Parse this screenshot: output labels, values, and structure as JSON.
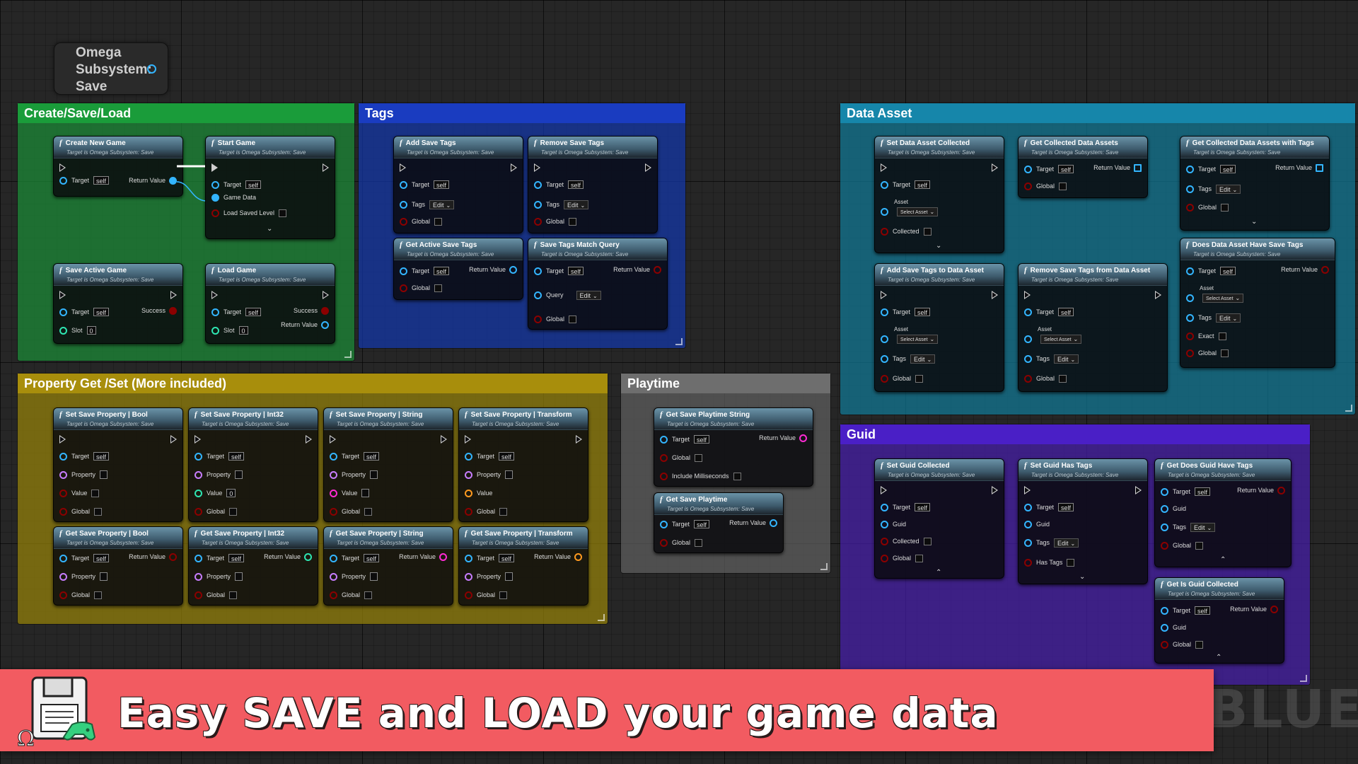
{
  "reference_node": {
    "label": "Omega Subsystem: Save"
  },
  "subtitle": "Target is Omega Subsystem: Save",
  "target_default": "self",
  "comments": [
    {
      "title": "Create/Save/Load"
    },
    {
      "title": "Tags"
    },
    {
      "title": "Data Asset"
    },
    {
      "title": "Property Get /Set (More included)"
    },
    {
      "title": "Playtime"
    },
    {
      "title": "Guid"
    }
  ],
  "nodes": {
    "create_new_game": "Create New Game",
    "start_game": "Start Game",
    "save_active_game": "Save Active Game",
    "load_game": "Load Game",
    "add_save_tags": "Add Save Tags",
    "remove_save_tags": "Remove Save Tags",
    "get_active_save_tags": "Get Active Save Tags",
    "save_tags_match_query": "Save Tags Match Query",
    "set_data_asset_collected": "Set Data Asset Collected",
    "get_collected_data_assets": "Get Collected Data Assets",
    "get_collected_data_assets_with_tags": "Get Collected Data Assets with Tags",
    "add_save_tags_to_data_asset": "Add Save Tags to Data Asset",
    "remove_save_tags_from_data_asset": "Remove Save Tags from Data Asset",
    "does_data_asset_have_save_tags": "Does Data Asset Have Save Tags",
    "set_prop_bool": "Set Save Property | Bool",
    "set_prop_int32": "Set Save Property | Int32",
    "set_prop_string": "Set Save Property | String",
    "set_prop_transform": "Set Save Property | Transform",
    "get_prop_bool": "Get Save Property | Bool",
    "get_prop_int32": "Get Save Property | Int32",
    "get_prop_string": "Get Save Property | String",
    "get_prop_transform": "Get Save Property | Transform",
    "get_save_playtime_string": "Get Save Playtime String",
    "get_save_playtime": "Get Save Playtime",
    "set_guid_collected": "Set Guid Collected",
    "set_guid_has_tags": "Set Guid Has Tags",
    "get_does_guid_have_tags": "Get Does Guid Have Tags",
    "get_is_guid_collected": "Get Is Guid Collected"
  },
  "pins": {
    "target": "Target",
    "return_value": "Return Value",
    "game_data": "Game Data",
    "load_saved_level": "Load Saved Level",
    "success": "Success",
    "slot": "Slot",
    "tags": "Tags",
    "global": "Global",
    "query": "Query",
    "asset": "Asset",
    "collected": "Collected",
    "exact": "Exact",
    "property": "Property",
    "value": "Value",
    "include_ms": "Include Milliseconds",
    "guid": "Guid",
    "has_tags": "Has Tags"
  },
  "widgets": {
    "edit": "Edit",
    "select_asset": "Select Asset",
    "slot_value": "0",
    "int_value": "0"
  },
  "banner": {
    "text": "Easy SAVE and LOAD your game data",
    "bg": "#f25b61"
  },
  "watermark": "BLUEPR"
}
